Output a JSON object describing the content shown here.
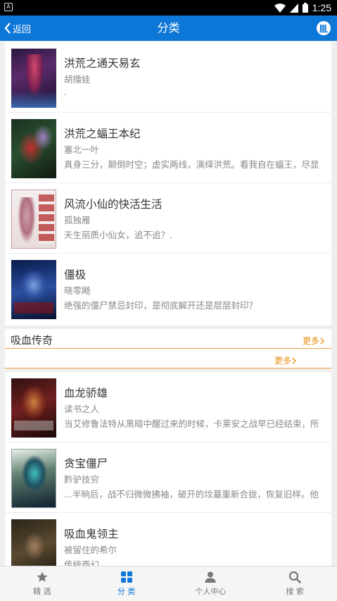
{
  "status_bar": {
    "time": "1:25"
  },
  "header": {
    "back_label": "返回",
    "title": "分类"
  },
  "books_top": [
    {
      "title": "洪荒之通天易玄",
      "author": "胡撸娃",
      "desc": "."
    },
    {
      "title": "洪荒之蝠王本纪",
      "author": "塞北一叶",
      "desc": "真身三分，颠倒时空；虚实两线，演绎洪荒。看我自在蝠王，尽显"
    },
    {
      "title": "风流小仙的快活生活",
      "author": "孤独雁",
      "desc": "天生丽质小仙女，追不追？."
    },
    {
      "title": "僵极",
      "author": "晓零飏",
      "desc": "绝强的僵尸禁忌封印，是彻底解开还是层层封印？"
    }
  ],
  "section": {
    "title": "吸血传奇",
    "more_label": "更多",
    "more_label_2": "更多"
  },
  "books_bottom": [
    {
      "title": "血龙骄雄",
      "author": "读书之人",
      "desc": "当艾修鲁法特从黑暗中醒过来的时候，卡莱安之战早已经结束，所"
    },
    {
      "title": "贪宝僵尸",
      "author": "黔驴技穷",
      "desc": "...半晌后，战不归微微拂袖，破开的坟墓重新合拢，恢复旧样。他"
    },
    {
      "title": "吸血鬼领主",
      "author": "被留住的希尔",
      "desc": "传统西幻"
    }
  ],
  "bottom_nav": [
    {
      "label": "精 选",
      "icon": "star-icon"
    },
    {
      "label": "分 类",
      "icon": "grid-icon"
    },
    {
      "label": "个人中心",
      "icon": "person-icon"
    },
    {
      "label": "搜 索",
      "icon": "search-icon"
    }
  ],
  "colors": {
    "primary": "#0d77d8",
    "accent_orange": "#e98f12",
    "background": "#efefef"
  }
}
